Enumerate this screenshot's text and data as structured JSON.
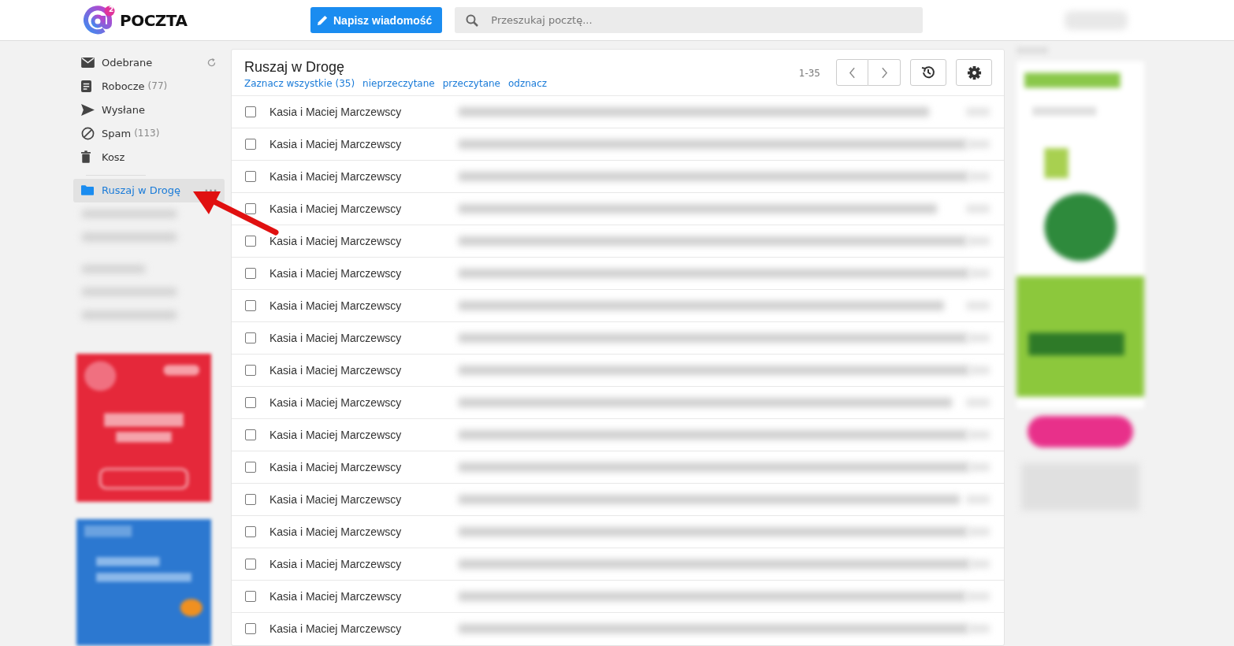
{
  "header": {
    "logo": "POCZTA",
    "logo_badge": "2",
    "compose_button": "Napisz wiadomość",
    "search": {
      "placeholder": "Przeszukaj pocztę..."
    }
  },
  "sidebar": {
    "items": [
      {
        "kind": "inbox",
        "label": "Odebrane",
        "selected": false
      },
      {
        "kind": "drafts",
        "label": "Robocze",
        "count": "(77)",
        "selected": false
      },
      {
        "kind": "sent",
        "label": "Wysłane",
        "selected": false
      },
      {
        "kind": "spam",
        "label": "Spam",
        "count": "(113)",
        "selected": false
      },
      {
        "kind": "trash",
        "label": "Kosz",
        "selected": false
      }
    ],
    "folders": [
      {
        "label": "Ruszaj w Drogę",
        "selected": true
      }
    ]
  },
  "list": {
    "title": "Ruszaj w Drogę",
    "actions": [
      "Zaznacz wszystkie (35)",
      "nieprzeczytane",
      "przeczytane",
      "odznacz"
    ],
    "range": "1-35",
    "rows": [
      {
        "sender": "Kasia i Maciej Marczewscy",
        "checked": false
      },
      {
        "sender": "Kasia i Maciej Marczewscy",
        "checked": false
      },
      {
        "sender": "Kasia i Maciej Marczewscy",
        "checked": false
      },
      {
        "sender": "Kasia i Maciej Marczewscy",
        "checked": false
      },
      {
        "sender": "Kasia i Maciej Marczewscy",
        "checked": false
      },
      {
        "sender": "Kasia i Maciej Marczewscy",
        "checked": false
      },
      {
        "sender": "Kasia i Maciej Marczewscy",
        "checked": false
      },
      {
        "sender": "Kasia i Maciej Marczewscy",
        "checked": false
      },
      {
        "sender": "Kasia i Maciej Marczewscy",
        "checked": false
      },
      {
        "sender": "Kasia i Maciej Marczewscy",
        "checked": false
      },
      {
        "sender": "Kasia i Maciej Marczewscy",
        "checked": false
      },
      {
        "sender": "Kasia i Maciej Marczewscy",
        "checked": false
      },
      {
        "sender": "Kasia i Maciej Marczewscy",
        "checked": false
      },
      {
        "sender": "Kasia i Maciej Marczewscy",
        "checked": false
      },
      {
        "sender": "Kasia i Maciej Marczewscy",
        "checked": false
      },
      {
        "sender": "Kasia i Maciej Marczewscy",
        "checked": false
      },
      {
        "sender": "Kasia i Maciej Marczewscy",
        "checked": false
      }
    ]
  }
}
